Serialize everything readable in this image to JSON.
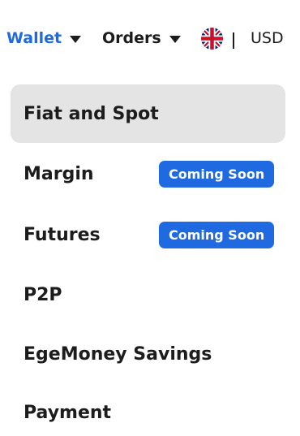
{
  "header": {
    "wallet_label": "Wallet",
    "orders_label": "Orders",
    "currency": "USD",
    "language_icon": "uk-flag-icon",
    "accent_color": "#1f6ae0"
  },
  "menu": {
    "items": [
      {
        "label": "Fiat and Spot",
        "active": true
      },
      {
        "label": "Margin",
        "badge": "Coming Soon"
      },
      {
        "label": "Futures",
        "badge": "Coming Soon"
      },
      {
        "label": "P2P"
      },
      {
        "label": "EgeMoney Savings"
      },
      {
        "label": "Payment"
      }
    ]
  }
}
